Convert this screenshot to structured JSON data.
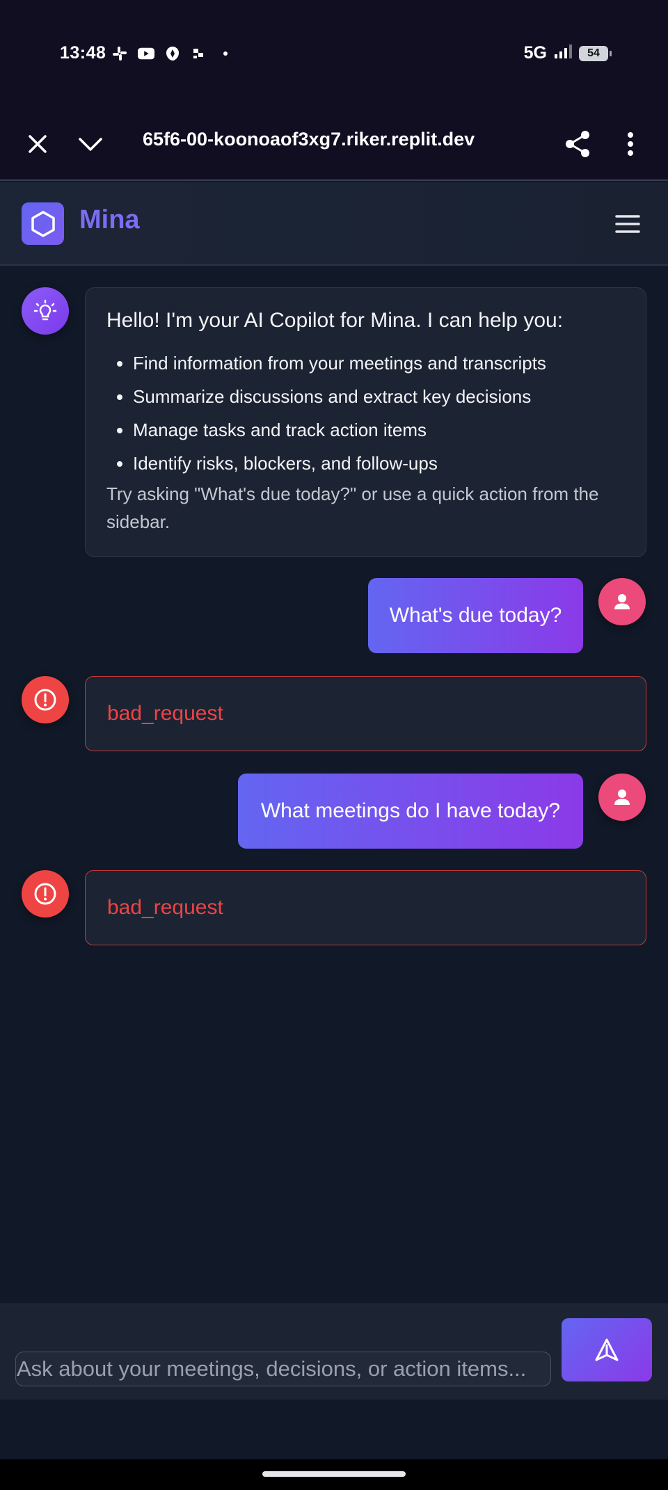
{
  "status_bar": {
    "time": "13:48",
    "network": "5G",
    "battery": "54",
    "icons": [
      "slack-icon",
      "youtube-icon",
      "bank-icon",
      "app-icon",
      "dot-icon",
      "signal-icon"
    ]
  },
  "browser": {
    "url": "65f6-00-koonoaof3xg7.riker.replit.dev",
    "icons": [
      "close-icon",
      "chevron-down-icon",
      "share-icon",
      "more-vert-icon"
    ]
  },
  "app": {
    "title": "Mina",
    "accent_color": "#6366f1",
    "logo_icon": "hexagon-icon",
    "menu_icon": "hamburger-icon"
  },
  "messages": [
    {
      "role": "assistant",
      "icon": "lightbulb-icon",
      "intro": "Hello! I'm your AI Copilot for Mina. I can help you:",
      "items": [
        "Find information from your meetings and transcripts",
        "Summarize discussions and extract key decisions",
        "Manage tasks and track action items",
        "Identify risks, blockers, and follow-ups"
      ],
      "hint": "Try asking \"What's due today?\" or use a quick action from the sidebar."
    },
    {
      "role": "user",
      "icon": "user-icon",
      "text": "What's due today?"
    },
    {
      "role": "error",
      "icon": "alert-circle-icon",
      "text": "bad_request",
      "color": "#ef4444"
    },
    {
      "role": "user",
      "icon": "user-icon",
      "text": "What meetings do I have today?"
    },
    {
      "role": "error",
      "icon": "alert-circle-icon",
      "text": "bad_request",
      "color": "#ef4444"
    }
  ],
  "composer": {
    "placeholder": "Ask about your meetings, decisions, or action items...",
    "value": "",
    "send_icon": "send-icon"
  }
}
